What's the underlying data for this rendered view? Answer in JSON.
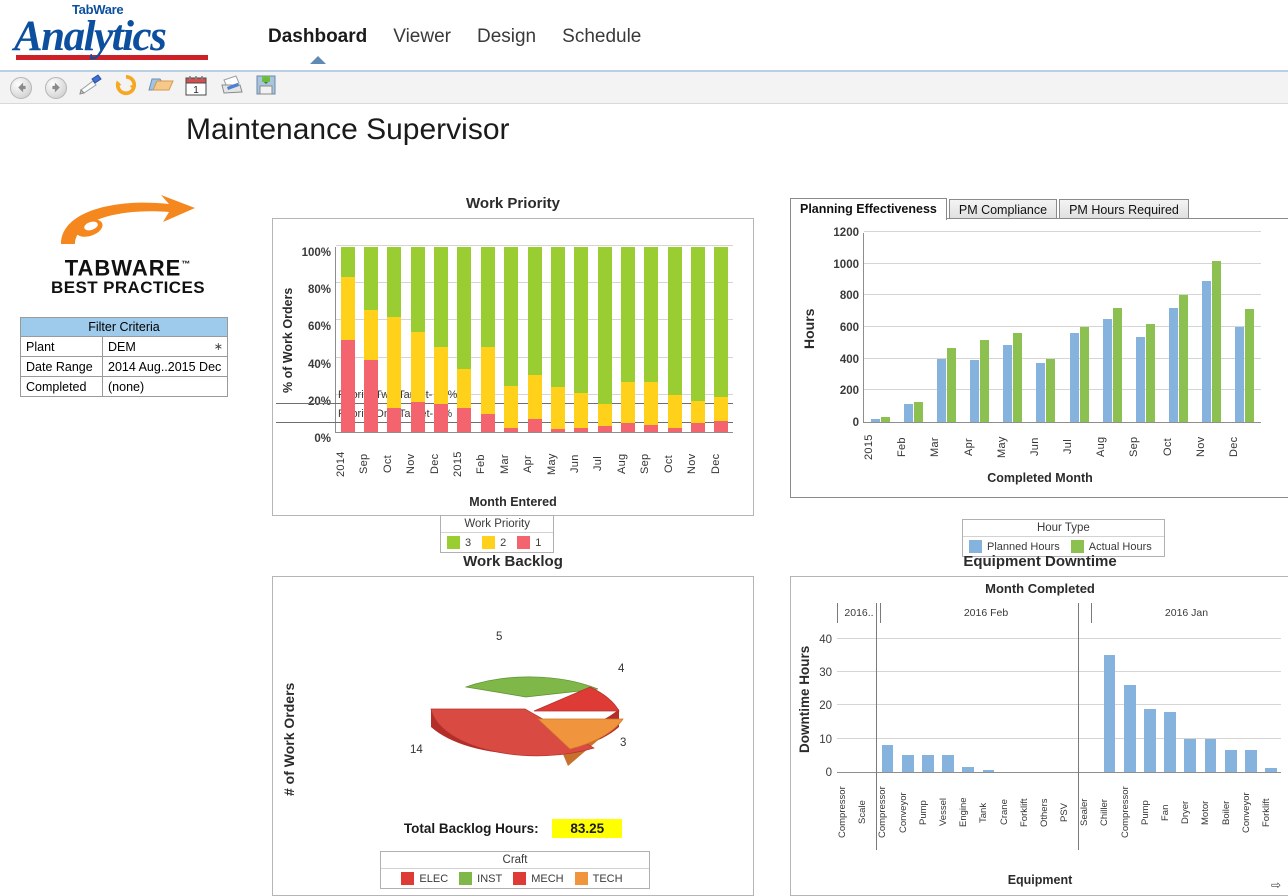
{
  "header": {
    "brand_sup": "TabWare",
    "brand_main": "Analytics",
    "nav": [
      {
        "label": "Dashboard",
        "active": true
      },
      {
        "label": "Viewer",
        "active": false
      },
      {
        "label": "Design",
        "active": false
      },
      {
        "label": "Schedule",
        "active": false
      }
    ]
  },
  "toolbar": {
    "buttons": [
      {
        "name": "back-icon",
        "title": "Back"
      },
      {
        "name": "forward-icon",
        "title": "Forward"
      },
      {
        "name": "edit-icon",
        "title": "Edit"
      },
      {
        "name": "refresh-icon",
        "title": "Refresh"
      },
      {
        "name": "open-folder-icon",
        "title": "Open"
      },
      {
        "name": "calendar-icon",
        "title": "Schedule"
      },
      {
        "name": "print-icon",
        "title": "Print"
      },
      {
        "name": "save-icon",
        "title": "Save"
      }
    ],
    "calendar_day": "1"
  },
  "page_title": "Maintenance Supervisor",
  "sidebar": {
    "logo_name": "TABWARE",
    "logo_tm": "™",
    "logo_sub": "BEST PRACTICES",
    "filter": {
      "title": "Filter Criteria",
      "rows": [
        {
          "label": "Plant",
          "value": "DEM",
          "has_dropdown": true
        },
        {
          "label": "Date Range",
          "value": "2014 Aug..2015 Dec",
          "has_dropdown": false
        },
        {
          "label": "Completed",
          "value": "(none)",
          "has_dropdown": false
        }
      ]
    }
  },
  "colors": {
    "priority3": "#9ACD32",
    "priority2": "#FFD11A",
    "priority1": "#F4646E",
    "planned": "#85b3dd",
    "actual": "#8CC152",
    "elec": "#DE3B36",
    "inst": "#7FB749",
    "mech": "#DE3B36",
    "tech": "#F0953E",
    "highlight": "#FFFF00",
    "brand_blue": "#0b4f9e",
    "brand_red": "#cf2027",
    "swoosh_orange": "#F5871F"
  },
  "panels": {
    "planning": {
      "tabs": [
        {
          "label": "Planning Effectiveness",
          "active": true
        },
        {
          "label": "PM Compliance",
          "active": false
        },
        {
          "label": "PM Hours Required",
          "active": false
        }
      ]
    },
    "downtime": {
      "scroll_arrow": "⇨"
    }
  },
  "chart_data": [
    {
      "type": "bar",
      "id": "work-priority",
      "title": "Work Priority",
      "xlabel": "Month Entered",
      "ylabel": "% of Work Orders",
      "stacked": true,
      "stack_order": [
        "1",
        "2",
        "3"
      ],
      "ylim": [
        0,
        100
      ],
      "yticks": [
        "0%",
        "20%",
        "40%",
        "60%",
        "80%",
        "100%"
      ],
      "grid": true,
      "categories": [
        "2014",
        "Sep",
        "Oct",
        "Nov",
        "Dec",
        "2015",
        "Feb",
        "Mar",
        "Apr",
        "May",
        "Jun",
        "Jul",
        "Aug",
        "Sep",
        "Oct",
        "Nov",
        "Dec"
      ],
      "legend": {
        "title": "Work Priority",
        "entries": [
          {
            "label": "3",
            "color": "#9ACD32"
          },
          {
            "label": "2",
            "color": "#FFD11A"
          },
          {
            "label": "1",
            "color": "#F4646E"
          }
        ]
      },
      "annotations": [
        {
          "text": "Priority Two Target- 15%",
          "y": 15
        },
        {
          "text": "Priority One Target- 5%",
          "y": 5
        }
      ],
      "series": [
        {
          "name": "1",
          "color": "#F4646E",
          "values": [
            50,
            39,
            13,
            16,
            15,
            13,
            10,
            2,
            7,
            1.5,
            2,
            3,
            5,
            4,
            2,
            5,
            6
          ]
        },
        {
          "name": "2",
          "color": "#FFD11A",
          "values": [
            34,
            27,
            49,
            38,
            31,
            21,
            36,
            23,
            24,
            23,
            19,
            12,
            22,
            23,
            18,
            12,
            13
          ]
        },
        {
          "name": "3",
          "color": "#9ACD32",
          "values": [
            16,
            34,
            38,
            46,
            54,
            66,
            54,
            75,
            69,
            75.5,
            79,
            85,
            73,
            73,
            80,
            83,
            81
          ]
        }
      ]
    },
    {
      "type": "bar",
      "id": "planning-effectiveness",
      "title": "Planning Effectiveness",
      "xlabel": "Completed Month",
      "ylabel": "Hours",
      "ylim": [
        0,
        1200
      ],
      "yticks": [
        "0",
        "200",
        "400",
        "600",
        "800",
        "1000",
        "1200"
      ],
      "grid": true,
      "categories": [
        "2015",
        "Feb",
        "Mar",
        "Apr",
        "May",
        "Jun",
        "Jul",
        "Aug",
        "Sep",
        "Oct",
        "Nov",
        "Dec"
      ],
      "legend": {
        "title": "Hour Type",
        "entries": [
          {
            "label": "Planned Hours",
            "color": "#85b3dd"
          },
          {
            "label": "Actual Hours",
            "color": "#8CC152"
          }
        ]
      },
      "series": [
        {
          "name": "Planned Hours",
          "color": "#85b3dd",
          "values": [
            20,
            115,
            395,
            390,
            485,
            370,
            565,
            650,
            535,
            720,
            890,
            600
          ]
        },
        {
          "name": "Actual Hours",
          "color": "#8CC152",
          "values": [
            30,
            125,
            470,
            520,
            565,
            400,
            600,
            720,
            620,
            805,
            1020,
            715
          ]
        }
      ]
    },
    {
      "type": "pie",
      "id": "work-backlog",
      "title": "Work Backlog",
      "ylabel": "# of Work Orders",
      "labels": [
        "ELEC",
        "INST",
        "MECH",
        "TECH"
      ],
      "values": [
        14,
        5,
        4,
        3
      ],
      "colors": [
        "#DE3B36",
        "#7FB749",
        "#DE3B36",
        "#F0953E"
      ],
      "legend": {
        "title": "Craft",
        "entries": [
          {
            "label": "ELEC",
            "color": "#DE3B36"
          },
          {
            "label": "INST",
            "color": "#7FB749"
          },
          {
            "label": "MECH",
            "color": "#DE3B36"
          },
          {
            "label": "TECH",
            "color": "#F0953E"
          }
        ]
      },
      "total_label": "Total Backlog Hours:",
      "total_value": "83.25"
    },
    {
      "type": "bar",
      "id": "equipment-downtime",
      "title": "Equipment Downtime",
      "group_axis_title": "Month Completed",
      "xlabel": "Equipment",
      "ylabel": "Downtime Hours",
      "ylim": [
        0,
        45
      ],
      "yticks": [
        "0",
        "10",
        "20",
        "30",
        "40"
      ],
      "grid": true,
      "groups": [
        {
          "label": "2016..",
          "count": 2
        },
        {
          "label": "2016 Feb",
          "count": 10
        },
        {
          "label": "2016 Jan",
          "count": 9
        }
      ],
      "categories": [
        "Compressor",
        "Scale",
        "Compressor",
        "Conveyor",
        "Pump",
        "Vessel",
        "Engine",
        "Tank",
        "Crane",
        "Forklift",
        "Others",
        "PSV",
        "Sealer",
        "Chiller",
        "Compressor",
        "Pump",
        "Fan",
        "Dryer",
        "Motor",
        "Boiler",
        "Conveyor",
        "Forklift"
      ],
      "values": [
        0,
        0,
        8,
        5,
        5,
        5,
        1.5,
        0.5,
        0,
        0,
        0,
        0,
        0,
        35,
        26,
        19,
        18,
        10,
        10,
        6.5,
        6.5,
        1.2
      ],
      "bar_color": "#85b3dd"
    }
  ]
}
